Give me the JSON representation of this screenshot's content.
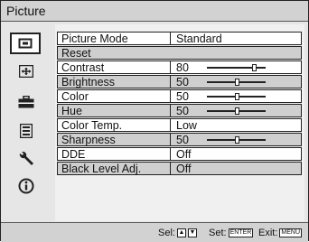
{
  "menu_title": "Picture",
  "sidebar": {
    "items": [
      {
        "icon": "picture-icon",
        "selected": true
      },
      {
        "icon": "screen-icon",
        "selected": false
      },
      {
        "icon": "setup-icon",
        "selected": false
      },
      {
        "icon": "function-icon",
        "selected": false
      },
      {
        "icon": "wrench-icon",
        "selected": false
      },
      {
        "icon": "info-icon",
        "selected": false
      }
    ]
  },
  "settings": {
    "picture_mode": {
      "label": "Picture Mode",
      "value": "Standard"
    },
    "reset": {
      "label": "Reset"
    },
    "contrast": {
      "label": "Contrast",
      "value": "80"
    },
    "brightness": {
      "label": "Brightness",
      "value": "50"
    },
    "color": {
      "label": "Color",
      "value": "50"
    },
    "hue": {
      "label": "Hue",
      "value": "50"
    },
    "color_temp": {
      "label": "Color Temp.",
      "value": "Low"
    },
    "sharpness": {
      "label": "Sharpness",
      "value": "50"
    },
    "dde": {
      "label": "DDE",
      "value": "Off"
    },
    "black_level": {
      "label": "Black Level Adj.",
      "value": "Off"
    }
  },
  "help_bar": {
    "select_label": "Sel:",
    "set_label": "Set:",
    "set_key": "ENTER",
    "exit_label": "Exit:",
    "exit_key": "MENU"
  }
}
